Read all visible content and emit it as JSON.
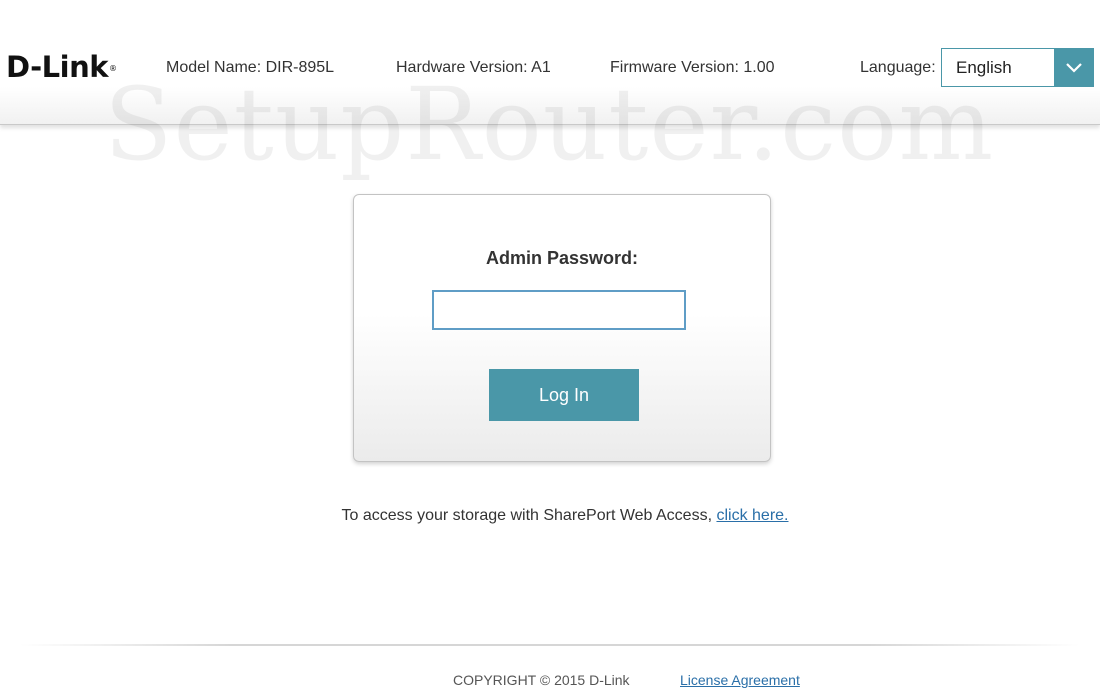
{
  "header": {
    "logo_text": "D-Link",
    "logo_mark": "®",
    "model_name": "Model Name: DIR-895L",
    "hardware_version": "Hardware Version: A1",
    "firmware_version": "Firmware Version: 1.00",
    "language_label": "Language:",
    "language_value": "English",
    "language_icon": "chevron-down-icon"
  },
  "watermark": "SetupRouter.com",
  "login": {
    "label": "Admin Password:",
    "password_value": "",
    "button_label": "Log In"
  },
  "shareport": {
    "text": "To access your storage with SharePort Web Access, ",
    "link": "click here."
  },
  "footer": {
    "copyright": "COPYRIGHT © 2015 D-Link",
    "license_link": "License Agreement"
  },
  "colors": {
    "accent": "#4a97a8",
    "link": "#2a6fa8"
  }
}
